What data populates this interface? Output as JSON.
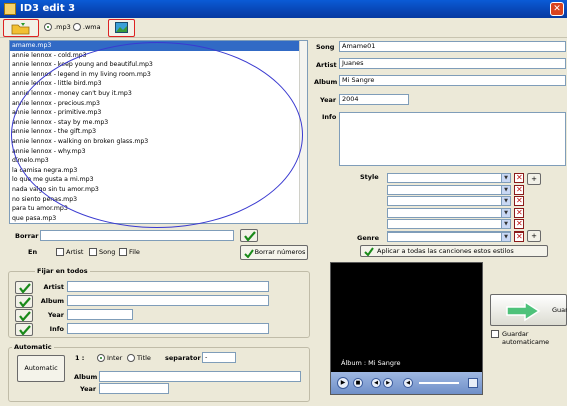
{
  "window": {
    "title": "ID3 edit 3"
  },
  "toolbar": {
    "filter_mp3": ".mp3",
    "filter_wma": ".wma"
  },
  "files": [
    "amame.mp3",
    "annie lennox - cold.mp3",
    "annie lennox - keep young and beautiful.mp3",
    "annie lennox - legend in my living room.mp3",
    "annie lennox - little bird.mp3",
    "annie lennox - money can't buy it.mp3",
    "annie lennox - precious.mp3",
    "annie lennox - primitive.mp3",
    "annie lennox - stay by me.mp3",
    "annie lennox - the gift.mp3",
    "annie lennox - walking on broken glass.mp3",
    "annie lennox - why.mp3",
    "dímelo.mp3",
    "la camisa negra.mp3",
    "lo que me gusta a mi.mp3",
    "nada valgo sin tu amor.mp3",
    "no siento penas.mp3",
    "para tu amor.mp3",
    "que pasa.mp3"
  ],
  "tags": {
    "song_label": "Song",
    "song_value": "Amame01",
    "artist_label": "Artist",
    "artist_value": "Juanes",
    "album_label": "Album",
    "album_value": "Mi Sangre",
    "year_label": "Year",
    "year_value": "2004",
    "info_label": "Info",
    "style_label": "Style",
    "genre_label": "Genre",
    "apply_all_label": "Aplicar a todas las canciones estos estilos"
  },
  "borrar": {
    "label": "Borrar",
    "en_label": "En",
    "artist": "Artist",
    "song": "Song",
    "file": "File",
    "borrar_numeros": "Borrar números"
  },
  "fijar": {
    "title": "Fijar en todos",
    "artist": "Artist",
    "album": "Album",
    "year": "Year",
    "info": "Info"
  },
  "automatic": {
    "title": "Automatic",
    "button": "Automatic",
    "one": "1 :",
    "inter": "Inter",
    "title_opt": "Title",
    "separator_label": "separator",
    "separator_value": "-",
    "album": "Album",
    "year": "Year"
  },
  "player": {
    "caption": "Álbum : Mi Sangre"
  },
  "save": {
    "label": "Guar",
    "auto_label": "Guardar automaticame"
  }
}
